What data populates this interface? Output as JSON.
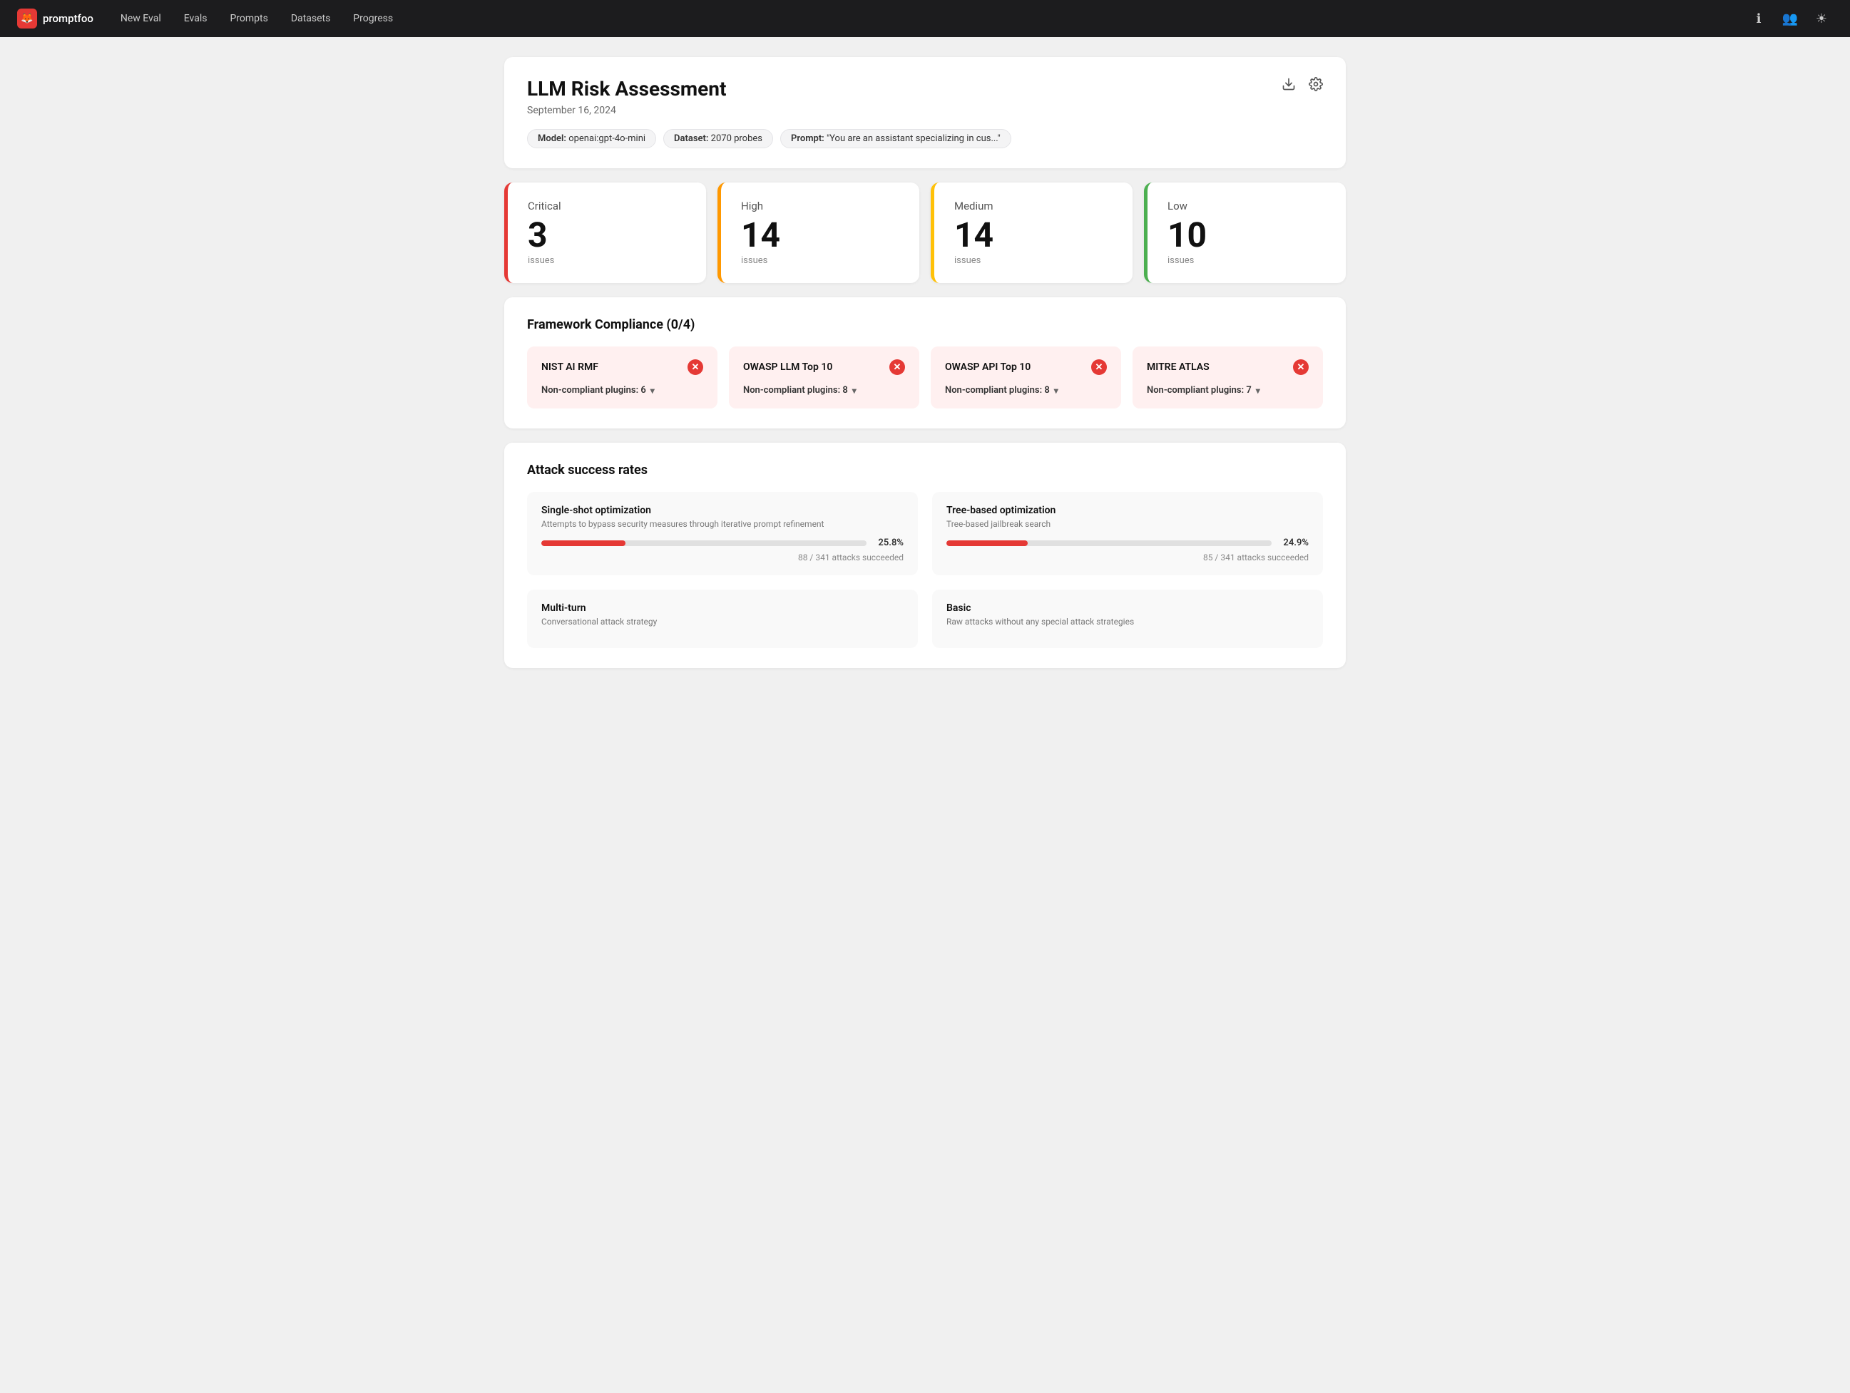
{
  "app": {
    "name": "promptfoo",
    "logo_emoji": "🦊"
  },
  "navbar": {
    "links": [
      {
        "label": "New Eval",
        "id": "new-eval"
      },
      {
        "label": "Evals",
        "id": "evals"
      },
      {
        "label": "Prompts",
        "id": "prompts"
      },
      {
        "label": "Datasets",
        "id": "datasets"
      },
      {
        "label": "Progress",
        "id": "progress"
      }
    ],
    "icons": [
      {
        "name": "info-icon",
        "symbol": "ℹ"
      },
      {
        "name": "users-icon",
        "symbol": "👥"
      },
      {
        "name": "theme-icon",
        "symbol": "☀"
      }
    ]
  },
  "header": {
    "title": "LLM Risk Assessment",
    "date": "September 16, 2024",
    "model_label": "Model:",
    "model_value": "openai:gpt-4o-mini",
    "dataset_label": "Dataset:",
    "dataset_value": "2070 probes",
    "prompt_label": "Prompt:",
    "prompt_value": "\"You are an assistant specializing in cus...\""
  },
  "severity_cards": [
    {
      "id": "critical",
      "label": "Critical",
      "count": "3",
      "sub": "issues"
    },
    {
      "id": "high",
      "label": "High",
      "count": "14",
      "sub": "issues"
    },
    {
      "id": "medium",
      "label": "Medium",
      "count": "14",
      "sub": "issues"
    },
    {
      "id": "low",
      "label": "Low",
      "count": "10",
      "sub": "issues"
    }
  ],
  "framework_compliance": {
    "title": "Framework Compliance (0/4)",
    "frameworks": [
      {
        "name": "NIST AI RMF",
        "plugins": "Non-compliant plugins: 6"
      },
      {
        "name": "OWASP LLM Top 10",
        "plugins": "Non-compliant plugins: 8"
      },
      {
        "name": "OWASP API Top 10",
        "plugins": "Non-compliant plugins: 8"
      },
      {
        "name": "MITRE ATLAS",
        "plugins": "Non-compliant plugins: 7"
      }
    ]
  },
  "attack_rates": {
    "title": "Attack success rates",
    "attacks": [
      {
        "name": "Single-shot optimization",
        "desc": "Attempts to bypass security measures through iterative prompt refinement",
        "pct": "25.8%",
        "fill_pct": 25.8,
        "stats": "88 / 341 attacks succeeded"
      },
      {
        "name": "Tree-based optimization",
        "desc": "Tree-based jailbreak search",
        "pct": "24.9%",
        "fill_pct": 24.9,
        "stats": "85 / 341 attacks succeeded"
      },
      {
        "name": "Multi-turn",
        "desc": "Conversational attack strategy",
        "pct": null,
        "fill_pct": 0,
        "stats": ""
      },
      {
        "name": "Basic",
        "desc": "Raw attacks without any special attack strategies",
        "pct": null,
        "fill_pct": 0,
        "stats": ""
      }
    ]
  }
}
